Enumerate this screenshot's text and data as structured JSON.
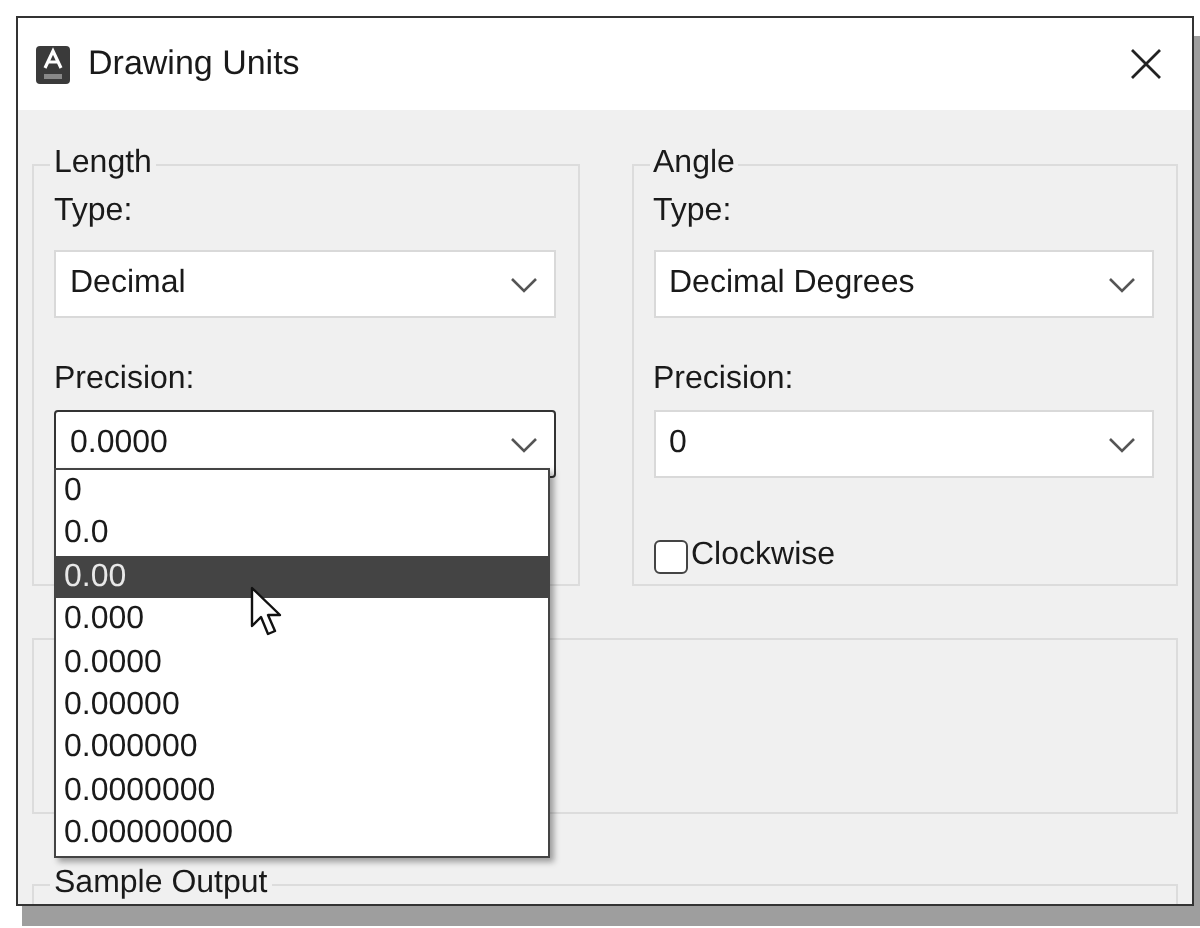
{
  "window": {
    "title": "Drawing Units"
  },
  "length": {
    "legend": "Length",
    "type_label": "Type:",
    "type_value": "Decimal",
    "precision_label": "Precision:",
    "precision_value": "0.0000",
    "precision_focused": true
  },
  "precision_dropdown": {
    "options": [
      {
        "label": "0",
        "selected": false
      },
      {
        "label": "0.0",
        "selected": false
      },
      {
        "label": "0.00",
        "selected": true
      },
      {
        "label": "0.000",
        "selected": false
      },
      {
        "label": "0.0000",
        "selected": false
      },
      {
        "label": "0.00000",
        "selected": false
      },
      {
        "label": "0.000000",
        "selected": false
      },
      {
        "label": "0.0000000",
        "selected": false
      },
      {
        "label": "0.00000000",
        "selected": false
      }
    ]
  },
  "angle": {
    "legend": "Angle",
    "type_label": "Type:",
    "type_value": "Decimal Degrees",
    "precision_label": "Precision:",
    "precision_value": "0",
    "clockwise": {
      "label": "Clockwise",
      "checked": false
    }
  },
  "sample_output": {
    "legend": "Sample Output"
  }
}
